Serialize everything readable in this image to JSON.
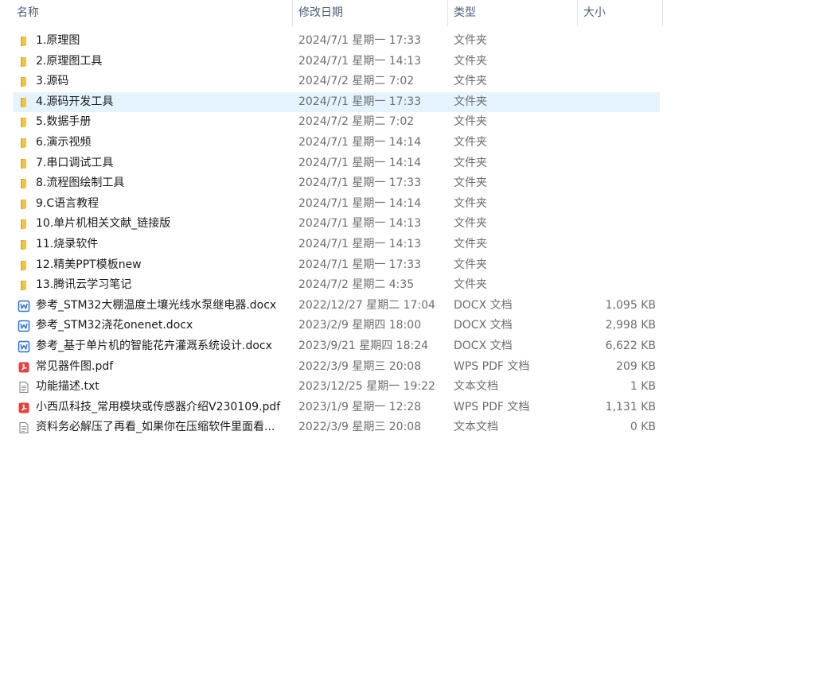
{
  "columns": {
    "name": "名称",
    "date": "修改日期",
    "type": "类型",
    "size": "大小"
  },
  "sort_indicator": "^",
  "colors": {
    "folder": "#f5c243",
    "folder_dark": "#e3a520",
    "word": "#2b6fd6",
    "pdf": "#e8403f",
    "selected_row": "#e5f3ff"
  },
  "files": [
    {
      "icon": "folder-icon",
      "name": "1.原理图",
      "date": "2024/7/1 星期一 17:33",
      "type": "文件夹",
      "size": ""
    },
    {
      "icon": "folder-icon",
      "name": "2.原理图工具",
      "date": "2024/7/1 星期一 14:13",
      "type": "文件夹",
      "size": ""
    },
    {
      "icon": "folder-icon",
      "name": "3.源码",
      "date": "2024/7/2 星期二 7:02",
      "type": "文件夹",
      "size": ""
    },
    {
      "icon": "folder-icon",
      "name": "4.源码开发工具",
      "date": "2024/7/1 星期一 17:33",
      "type": "文件夹",
      "size": "",
      "selected": true
    },
    {
      "icon": "folder-icon",
      "name": "5.数据手册",
      "date": "2024/7/2 星期二 7:02",
      "type": "文件夹",
      "size": ""
    },
    {
      "icon": "folder-icon",
      "name": "6.演示视频",
      "date": "2024/7/1 星期一 14:14",
      "type": "文件夹",
      "size": ""
    },
    {
      "icon": "folder-icon",
      "name": "7.串口调试工具",
      "date": "2024/7/1 星期一 14:14",
      "type": "文件夹",
      "size": ""
    },
    {
      "icon": "folder-icon",
      "name": "8.流程图绘制工具",
      "date": "2024/7/1 星期一 17:33",
      "type": "文件夹",
      "size": ""
    },
    {
      "icon": "folder-icon",
      "name": "9.C语言教程",
      "date": "2024/7/1 星期一 14:14",
      "type": "文件夹",
      "size": ""
    },
    {
      "icon": "folder-icon",
      "name": "10.单片机相关文献_链接版",
      "date": "2024/7/1 星期一 14:13",
      "type": "文件夹",
      "size": ""
    },
    {
      "icon": "folder-icon",
      "name": "11.烧录软件",
      "date": "2024/7/1 星期一 14:13",
      "type": "文件夹",
      "size": ""
    },
    {
      "icon": "folder-icon",
      "name": "12.精美PPT模板new",
      "date": "2024/7/1 星期一 17:33",
      "type": "文件夹",
      "size": ""
    },
    {
      "icon": "folder-icon",
      "name": "13.腾讯云学习笔记",
      "date": "2024/7/2 星期二 4:35",
      "type": "文件夹",
      "size": ""
    },
    {
      "icon": "word-doc-icon",
      "name": "参考_STM32大棚温度土壤光线水泵继电器.docx",
      "date": "2022/12/27 星期二 17:04",
      "type": "DOCX 文档",
      "size": "1,095 KB"
    },
    {
      "icon": "word-doc-icon",
      "name": "参考_STM32浇花onenet.docx",
      "date": "2023/2/9 星期四 18:00",
      "type": "DOCX 文档",
      "size": "2,998 KB"
    },
    {
      "icon": "word-doc-icon",
      "name": "参考_基于单片机的智能花卉灌溉系统设计.docx",
      "date": "2023/9/21 星期四 18:24",
      "type": "DOCX 文档",
      "size": "6,622 KB"
    },
    {
      "icon": "pdf-icon",
      "name": "常见器件图.pdf",
      "date": "2022/3/9 星期三 20:08",
      "type": "WPS PDF 文档",
      "size": "209 KB"
    },
    {
      "icon": "text-file-icon",
      "name": "功能描述.txt",
      "date": "2023/12/25 星期一 19:22",
      "type": "文本文档",
      "size": "1 KB"
    },
    {
      "icon": "pdf-icon",
      "name": "小西瓜科技_常用模块或传感器介绍V230109.pdf",
      "date": "2023/1/9 星期一 12:28",
      "type": "WPS PDF 文档",
      "size": "1,131 KB"
    },
    {
      "icon": "text-file-icon",
      "name": "资料务必解压了再看_如果你在压缩软件里面看...",
      "date": "2022/3/9 星期三 20:08",
      "type": "文本文档",
      "size": "0 KB"
    }
  ]
}
